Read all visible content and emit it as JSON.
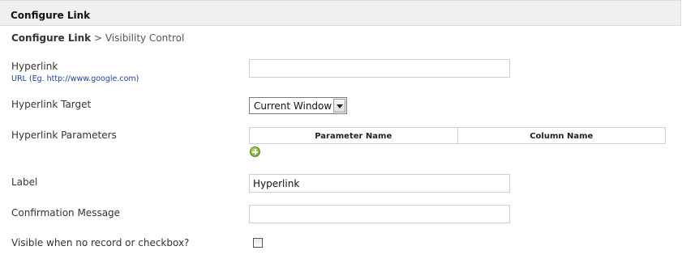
{
  "header": {
    "title": "Configure Link"
  },
  "breadcrumb": {
    "root": "Configure Link",
    "separator": " > ",
    "current": "Visibility Control"
  },
  "form": {
    "hyperlink": {
      "label": "Hyperlink",
      "hint": "URL (Eg. http://www.google.com)",
      "value": ""
    },
    "target": {
      "label": "Hyperlink Target",
      "selected": "Current Window"
    },
    "parameters": {
      "label": "Hyperlink Parameters",
      "columns": [
        "Parameter Name",
        "Column Name"
      ]
    },
    "label_field": {
      "label": "Label",
      "value": "Hyperlink"
    },
    "confirmation": {
      "label": "Confirmation Message",
      "value": ""
    },
    "visible_checkbox": {
      "label": "Visible when no record or checkbox?",
      "checked": false
    }
  }
}
